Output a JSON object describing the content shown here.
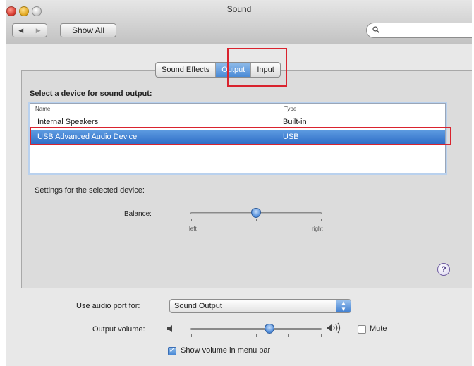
{
  "window": {
    "title": "Sound"
  },
  "toolbar": {
    "back_glyph": "◀",
    "forward_glyph": "▶",
    "show_all": "Show All",
    "search_placeholder": ""
  },
  "tabs": [
    {
      "label": "Sound Effects",
      "active": false
    },
    {
      "label": "Output",
      "active": true
    },
    {
      "label": "Input",
      "active": false
    }
  ],
  "output": {
    "section_title": "Select a device for sound output:",
    "columns": [
      "Name",
      "Type"
    ],
    "devices": [
      {
        "name": "Internal Speakers",
        "type": "Built-in",
        "selected": false
      },
      {
        "name": "USB Advanced Audio Device",
        "type": "USB",
        "selected": true
      }
    ],
    "settings_label": "Settings for the selected device:",
    "balance": {
      "label": "Balance:",
      "left_label": "left",
      "right_label": "right",
      "value": 0.5
    }
  },
  "bottom": {
    "audio_port_label": "Use audio port for:",
    "audio_port_value": "Sound Output",
    "output_volume_label": "Output volume:",
    "output_volume_value": 0.6,
    "mute_label": "Mute",
    "mute_checked": false,
    "menu_bar_label": "Show volume in menu bar",
    "menu_bar_checked": true
  },
  "help_glyph": "?",
  "colors": {
    "selection": "#3b78cf",
    "annotation": "#d9232e"
  }
}
